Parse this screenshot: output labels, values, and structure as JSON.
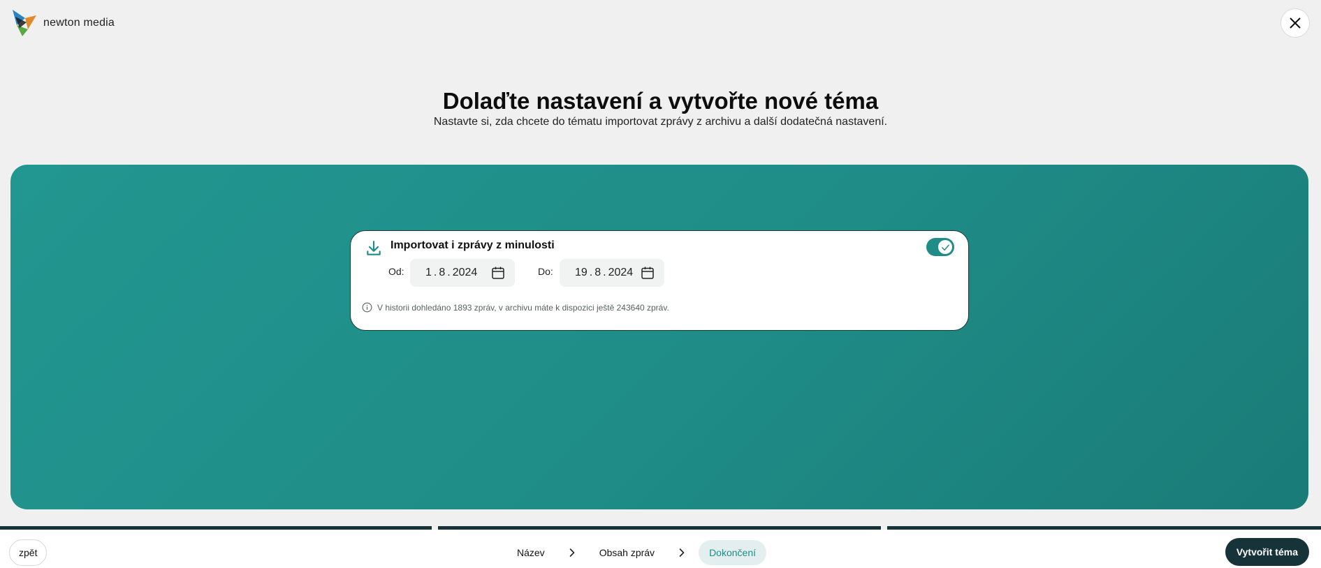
{
  "header": {
    "logo_text": "newton media",
    "close_label": "close"
  },
  "heading": "Dolaďte nastavení a vytvořte nové téma",
  "subheading": "Nastavte si, zda chcete do tématu importovat zprávy z archivu a další dodatečná nastavení.",
  "import_card": {
    "title": "Importovat i zprávy z minulosti",
    "toggle_on": true,
    "from_label": "Od:",
    "from_date": {
      "day": "1",
      "month": "8",
      "year": "2024"
    },
    "to_label": "Do:",
    "to_date": {
      "day": "19",
      "month": "8",
      "year": "2024"
    },
    "info_text": "V historii dohledáno 1893 zpráv, v archivu máte k dispozici ještě 243640 zpráv."
  },
  "footer": {
    "back_label": "zpět",
    "steps": [
      {
        "label": "Název",
        "active": false
      },
      {
        "label": "Obsah zpráv",
        "active": false
      },
      {
        "label": "Dokončení",
        "active": true
      }
    ],
    "create_label": "Vytvořit téma"
  },
  "colors": {
    "teal": "#1f8c87",
    "dark": "#16333a",
    "background": "#eff0ef"
  },
  "icons": [
    "newton-logo",
    "close-icon",
    "download-icon",
    "check-icon",
    "calendar-icon",
    "info-icon",
    "chevron-right-icon"
  ]
}
